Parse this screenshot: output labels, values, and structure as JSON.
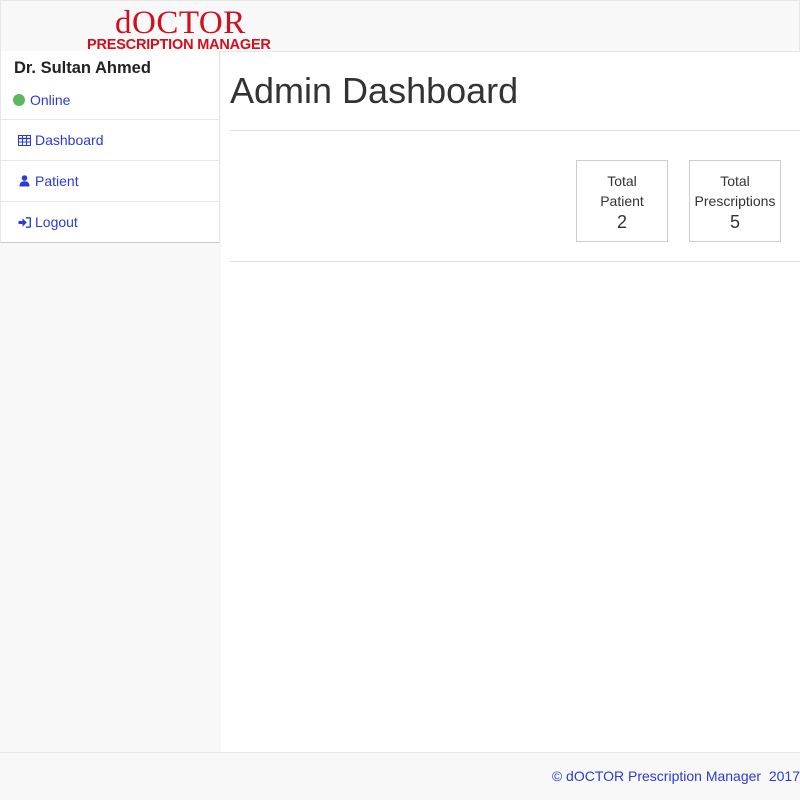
{
  "brand": {
    "title": "dOCTOR",
    "subtitle": "PRESCRIPTION MANAGER",
    "color": "#d0101e"
  },
  "user": {
    "name": "Dr. Sultan Ahmed",
    "status": "Online",
    "status_color": "#5cb85c"
  },
  "nav": {
    "items": [
      {
        "label": "Dashboard",
        "icon": "table-icon"
      },
      {
        "label": "Patient",
        "icon": "user-icon"
      },
      {
        "label": "Logout",
        "icon": "sign-in-icon"
      }
    ]
  },
  "main": {
    "title": "Admin Dashboard",
    "stats": [
      {
        "label_line1": "Total",
        "label_line2": "Patient",
        "value": "2"
      },
      {
        "label_line1": "Total",
        "label_line2": "Prescriptions",
        "value": "5"
      }
    ]
  },
  "footer": {
    "text": "© dOCTOR Prescription Manager  2017"
  },
  "colors": {
    "link": "#2a3bd8",
    "accent_red": "#d0101e"
  }
}
